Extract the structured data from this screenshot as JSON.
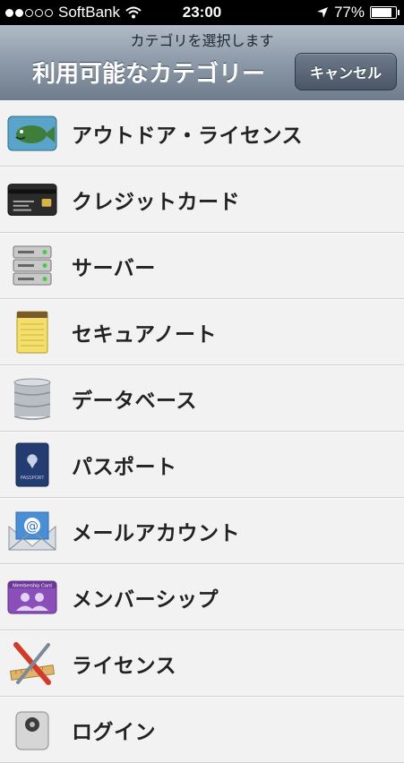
{
  "status_bar": {
    "carrier": "SoftBank",
    "time": "23:00",
    "battery": "77%",
    "signal_bars": 2,
    "battery_level": 0.77
  },
  "navbar": {
    "prompt": "カテゴリを選択します",
    "title": "利用可能なカテゴリー",
    "cancel_label": "キャンセル"
  },
  "categories": [
    {
      "label": "アウトドア・ライセンス",
      "icon": "fish-icon"
    },
    {
      "label": "クレジットカード",
      "icon": "credit-card-icon"
    },
    {
      "label": "サーバー",
      "icon": "server-icon"
    },
    {
      "label": "セキュアノート",
      "icon": "notepad-icon"
    },
    {
      "label": "データベース",
      "icon": "database-icon"
    },
    {
      "label": "パスポート",
      "icon": "passport-icon"
    },
    {
      "label": "メールアカウント",
      "icon": "mail-icon"
    },
    {
      "label": "メンバーシップ",
      "icon": "membership-card-icon"
    },
    {
      "label": "ライセンス",
      "icon": "license-tools-icon"
    },
    {
      "label": "ログイン",
      "icon": "login-icon"
    }
  ],
  "icon_text": {
    "membership": "Membership Card",
    "passport": "PASSPORT"
  }
}
